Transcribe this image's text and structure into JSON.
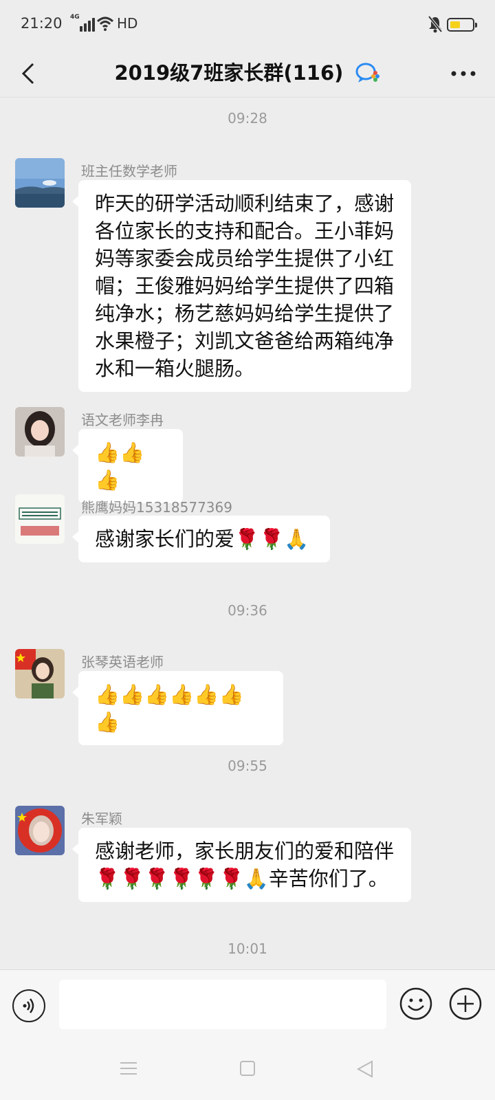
{
  "status_bar": {
    "time": "21:20",
    "network": "4G",
    "connection_label": "HD",
    "battery_color": "#f6d11a"
  },
  "header": {
    "title": "2019级7班家长群(116)"
  },
  "messages": [
    {
      "type": "time",
      "text": "09:28"
    },
    {
      "type": "msg",
      "sender": "班主任数学老师",
      "lines": [
        "昨天的研学活动顺利结束了，感谢",
        "各位家长的支持和配合。王小菲妈",
        "妈等家委会成员给学生提供了小红",
        "帽；王俊雅妈妈给学生提供了四箱",
        "纯净水；杨艺慈妈妈给学生提供了",
        "水果橙子；刘凯文爸爸给两箱纯净",
        "水和一箱火腿肠。"
      ]
    },
    {
      "type": "msg",
      "sender": "语文老师李冉",
      "text": "👍👍👍"
    },
    {
      "type": "msg",
      "sender": "熊鹰妈妈15318577369",
      "text": "感谢家长们的爱🌹🌹🙏"
    },
    {
      "type": "time",
      "text": "09:36"
    },
    {
      "type": "msg",
      "sender": "张琴英语老师",
      "text": "👍👍👍👍👍👍👍"
    },
    {
      "type": "time",
      "text": "09:55"
    },
    {
      "type": "msg",
      "sender": "朱军颖",
      "lines": [
        "感谢老师，家长朋友们的爱和陪伴",
        "🌹🌹🌹🌹🌹🌹🙏辛苦你们了。"
      ]
    },
    {
      "type": "time",
      "text": "10:01"
    }
  ],
  "input": {
    "placeholder": ""
  },
  "colors": {
    "background": "#ededed",
    "bubble": "#ffffff",
    "timestamp": "#9a9a9a",
    "sender": "#8c8c8c"
  }
}
